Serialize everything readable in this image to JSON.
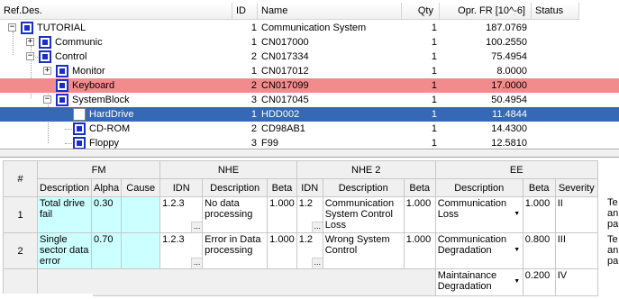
{
  "tree": {
    "columns": [
      "Ref.Des.",
      "ID",
      "Name",
      "Qty",
      "Opr. FR [10^-6]",
      "Status"
    ],
    "rows": [
      {
        "label": "TUTORIAL",
        "id": "1",
        "name": "Communication System",
        "qty": "1",
        "fr": "187.0769",
        "status": "",
        "expander": "−",
        "level": 0
      },
      {
        "label": "Communic",
        "id": "1",
        "name": "CN017000",
        "qty": "1",
        "fr": "100.2550",
        "status": "",
        "expander": "+",
        "level": 1
      },
      {
        "label": "Control",
        "id": "2",
        "name": "CN017334",
        "qty": "1",
        "fr": "75.4954",
        "status": "",
        "expander": "−",
        "level": 1
      },
      {
        "label": "Monitor",
        "id": "1",
        "name": "CN017012",
        "qty": "1",
        "fr": "8.0000",
        "status": "",
        "expander": "+",
        "level": 2
      },
      {
        "label": "Keyboard",
        "id": "2",
        "name": "CN017099",
        "qty": "1",
        "fr": "17.0000",
        "status": "",
        "expander": "",
        "level": 2
      },
      {
        "label": "SystemBlock",
        "id": "3",
        "name": "CN017045",
        "qty": "1",
        "fr": "50.4954",
        "status": "",
        "expander": "−",
        "level": 2
      },
      {
        "label": "HardDrive",
        "id": "1",
        "name": "HDD002",
        "qty": "1",
        "fr": "11.4844",
        "status": "",
        "expander": "",
        "level": 3
      },
      {
        "label": "CD-ROM",
        "id": "2",
        "name": "CD98AB1",
        "qty": "1",
        "fr": "14.4300",
        "status": "",
        "expander": "",
        "level": 3
      },
      {
        "label": "Floppy",
        "id": "3",
        "name": "F99",
        "qty": "1",
        "fr": "12.5810",
        "status": "",
        "expander": "",
        "level": 3
      }
    ]
  },
  "fmea": {
    "corner": "#",
    "groups": {
      "fm": "FM",
      "nhe": "NHE",
      "nhe2": "NHE 2",
      "ee": "EE"
    },
    "subheaders": {
      "description": "Description",
      "alpha": "Alpha",
      "cause": "Cause",
      "idn": "IDN",
      "beta": "Beta",
      "idn_short": "IDN",
      "severity": "Severity"
    },
    "rows": [
      {
        "num": "1",
        "fm_description": "Total drive fail",
        "alpha": "0.30",
        "cause": "",
        "nhe_idn": "1.2.3",
        "nhe_description": "No data processing",
        "nhe_beta": "1.000",
        "nhe2_idn": "1.2",
        "nhe2_description": "Communication System Control Loss",
        "nhe2_beta": "1.000",
        "ee_description": "Communication Loss",
        "ee_beta": "1.000",
        "ee_severity": "II",
        "overflow": "Te an pa"
      },
      {
        "num": "2",
        "fm_description": "Single sector data error",
        "alpha": "0.70",
        "cause": "",
        "nhe_idn": "1.2.3",
        "nhe_description": "Error in Data processing",
        "nhe_beta": "1.000",
        "nhe2_idn": "1.2",
        "nhe2_description": "Wrong System Control",
        "nhe2_beta": "1.000",
        "ee_description": "Communication Degradation",
        "ee_beta": "0.800",
        "ee_severity": "III",
        "overflow": "Te an pa"
      }
    ],
    "extra_ee": {
      "description": "Maintainance Degradation",
      "beta": "0.200",
      "severity": "IV"
    }
  }
}
